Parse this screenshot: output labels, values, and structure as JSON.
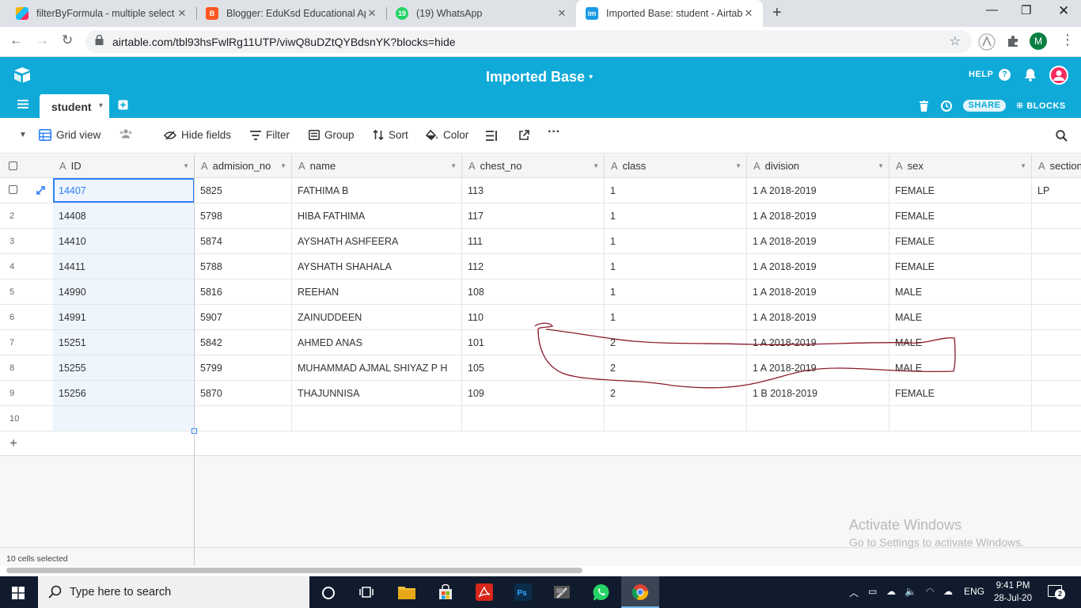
{
  "browser": {
    "tabs": [
      {
        "title": "filterByFormula - multiple select -",
        "active": false
      },
      {
        "title": "Blogger: EduKsd Educational App",
        "active": false
      },
      {
        "title": "(19) WhatsApp",
        "active": false,
        "badge": "19"
      },
      {
        "title": "Imported Base: student - Airtable",
        "active": true,
        "fav": "im"
      }
    ],
    "url": "airtable.com/tbl93hsFwlRg11UTP/viwQ8uDZtQYBdsnYK?blocks=hide",
    "profile_initial": "M"
  },
  "airtable": {
    "base_name": "Imported Base",
    "help_label": "HELP",
    "table_name": "student",
    "share_label": "SHARE",
    "blocks_label": "BLOCKS"
  },
  "viewbar": {
    "view_name": "Grid view",
    "hide_fields": "Hide fields",
    "filter": "Filter",
    "group": "Group",
    "sort": "Sort",
    "color": "Color"
  },
  "grid": {
    "columns": [
      "ID",
      "admision_no",
      "name",
      "chest_no",
      "class",
      "division",
      "sex",
      "section"
    ],
    "rows": [
      {
        "n": "",
        "id": "14407",
        "adm": "5825",
        "name": "FATHIMA B",
        "chest": "113",
        "cls": "1",
        "div": "1 A 2018-2019",
        "sex": "FEMALE",
        "sec": "LP"
      },
      {
        "n": "2",
        "id": "14408",
        "adm": "5798",
        "name": "HIBA FATHIMA",
        "chest": "117",
        "cls": "1",
        "div": "1 A 2018-2019",
        "sex": "FEMALE",
        "sec": ""
      },
      {
        "n": "3",
        "id": "14410",
        "adm": "5874",
        "name": "AYSHATH ASHFEERA",
        "chest": "111",
        "cls": "1",
        "div": "1 A 2018-2019",
        "sex": "FEMALE",
        "sec": ""
      },
      {
        "n": "4",
        "id": "14411",
        "adm": "5788",
        "name": "AYSHATH SHAHALA",
        "chest": "112",
        "cls": "1",
        "div": "1 A 2018-2019",
        "sex": "FEMALE",
        "sec": ""
      },
      {
        "n": "5",
        "id": "14990",
        "adm": "5816",
        "name": "REEHAN",
        "chest": "108",
        "cls": "1",
        "div": "1 A 2018-2019",
        "sex": "MALE",
        "sec": ""
      },
      {
        "n": "6",
        "id": "14991",
        "adm": "5907",
        "name": "ZAINUDDEEN",
        "chest": "110",
        "cls": "1",
        "div": "1 A 2018-2019",
        "sex": "MALE",
        "sec": ""
      },
      {
        "n": "7",
        "id": "15251",
        "adm": "5842",
        "name": "AHMED ANAS",
        "chest": "101",
        "cls": "2",
        "div": "1 A 2018-2019",
        "sex": "MALE",
        "sec": ""
      },
      {
        "n": "8",
        "id": "15255",
        "adm": "5799",
        "name": "MUHAMMAD AJMAL SHIYAZ P H",
        "chest": "105",
        "cls": "2",
        "div": "1 A 2018-2019",
        "sex": "MALE",
        "sec": ""
      },
      {
        "n": "9",
        "id": "15256",
        "adm": "5870",
        "name": "THAJUNNISA",
        "chest": "109",
        "cls": "2",
        "div": "1 B 2018-2019",
        "sex": "FEMALE",
        "sec": ""
      },
      {
        "n": "10",
        "id": "",
        "adm": "",
        "name": "",
        "chest": "",
        "cls": "",
        "div": "",
        "sex": "",
        "sec": ""
      }
    ],
    "status": "10 cells selected"
  },
  "watermark": {
    "line1": "Activate Windows",
    "line2": "Go to Settings to activate Windows."
  },
  "taskbar": {
    "search_placeholder": "Type here to search",
    "lang": "ENG",
    "time": "9:41 PM",
    "date": "28-Jul-20",
    "notifications": "2"
  },
  "colors": {
    "airtable_blue": "#0faad8",
    "taskbar": "#101b2d"
  }
}
